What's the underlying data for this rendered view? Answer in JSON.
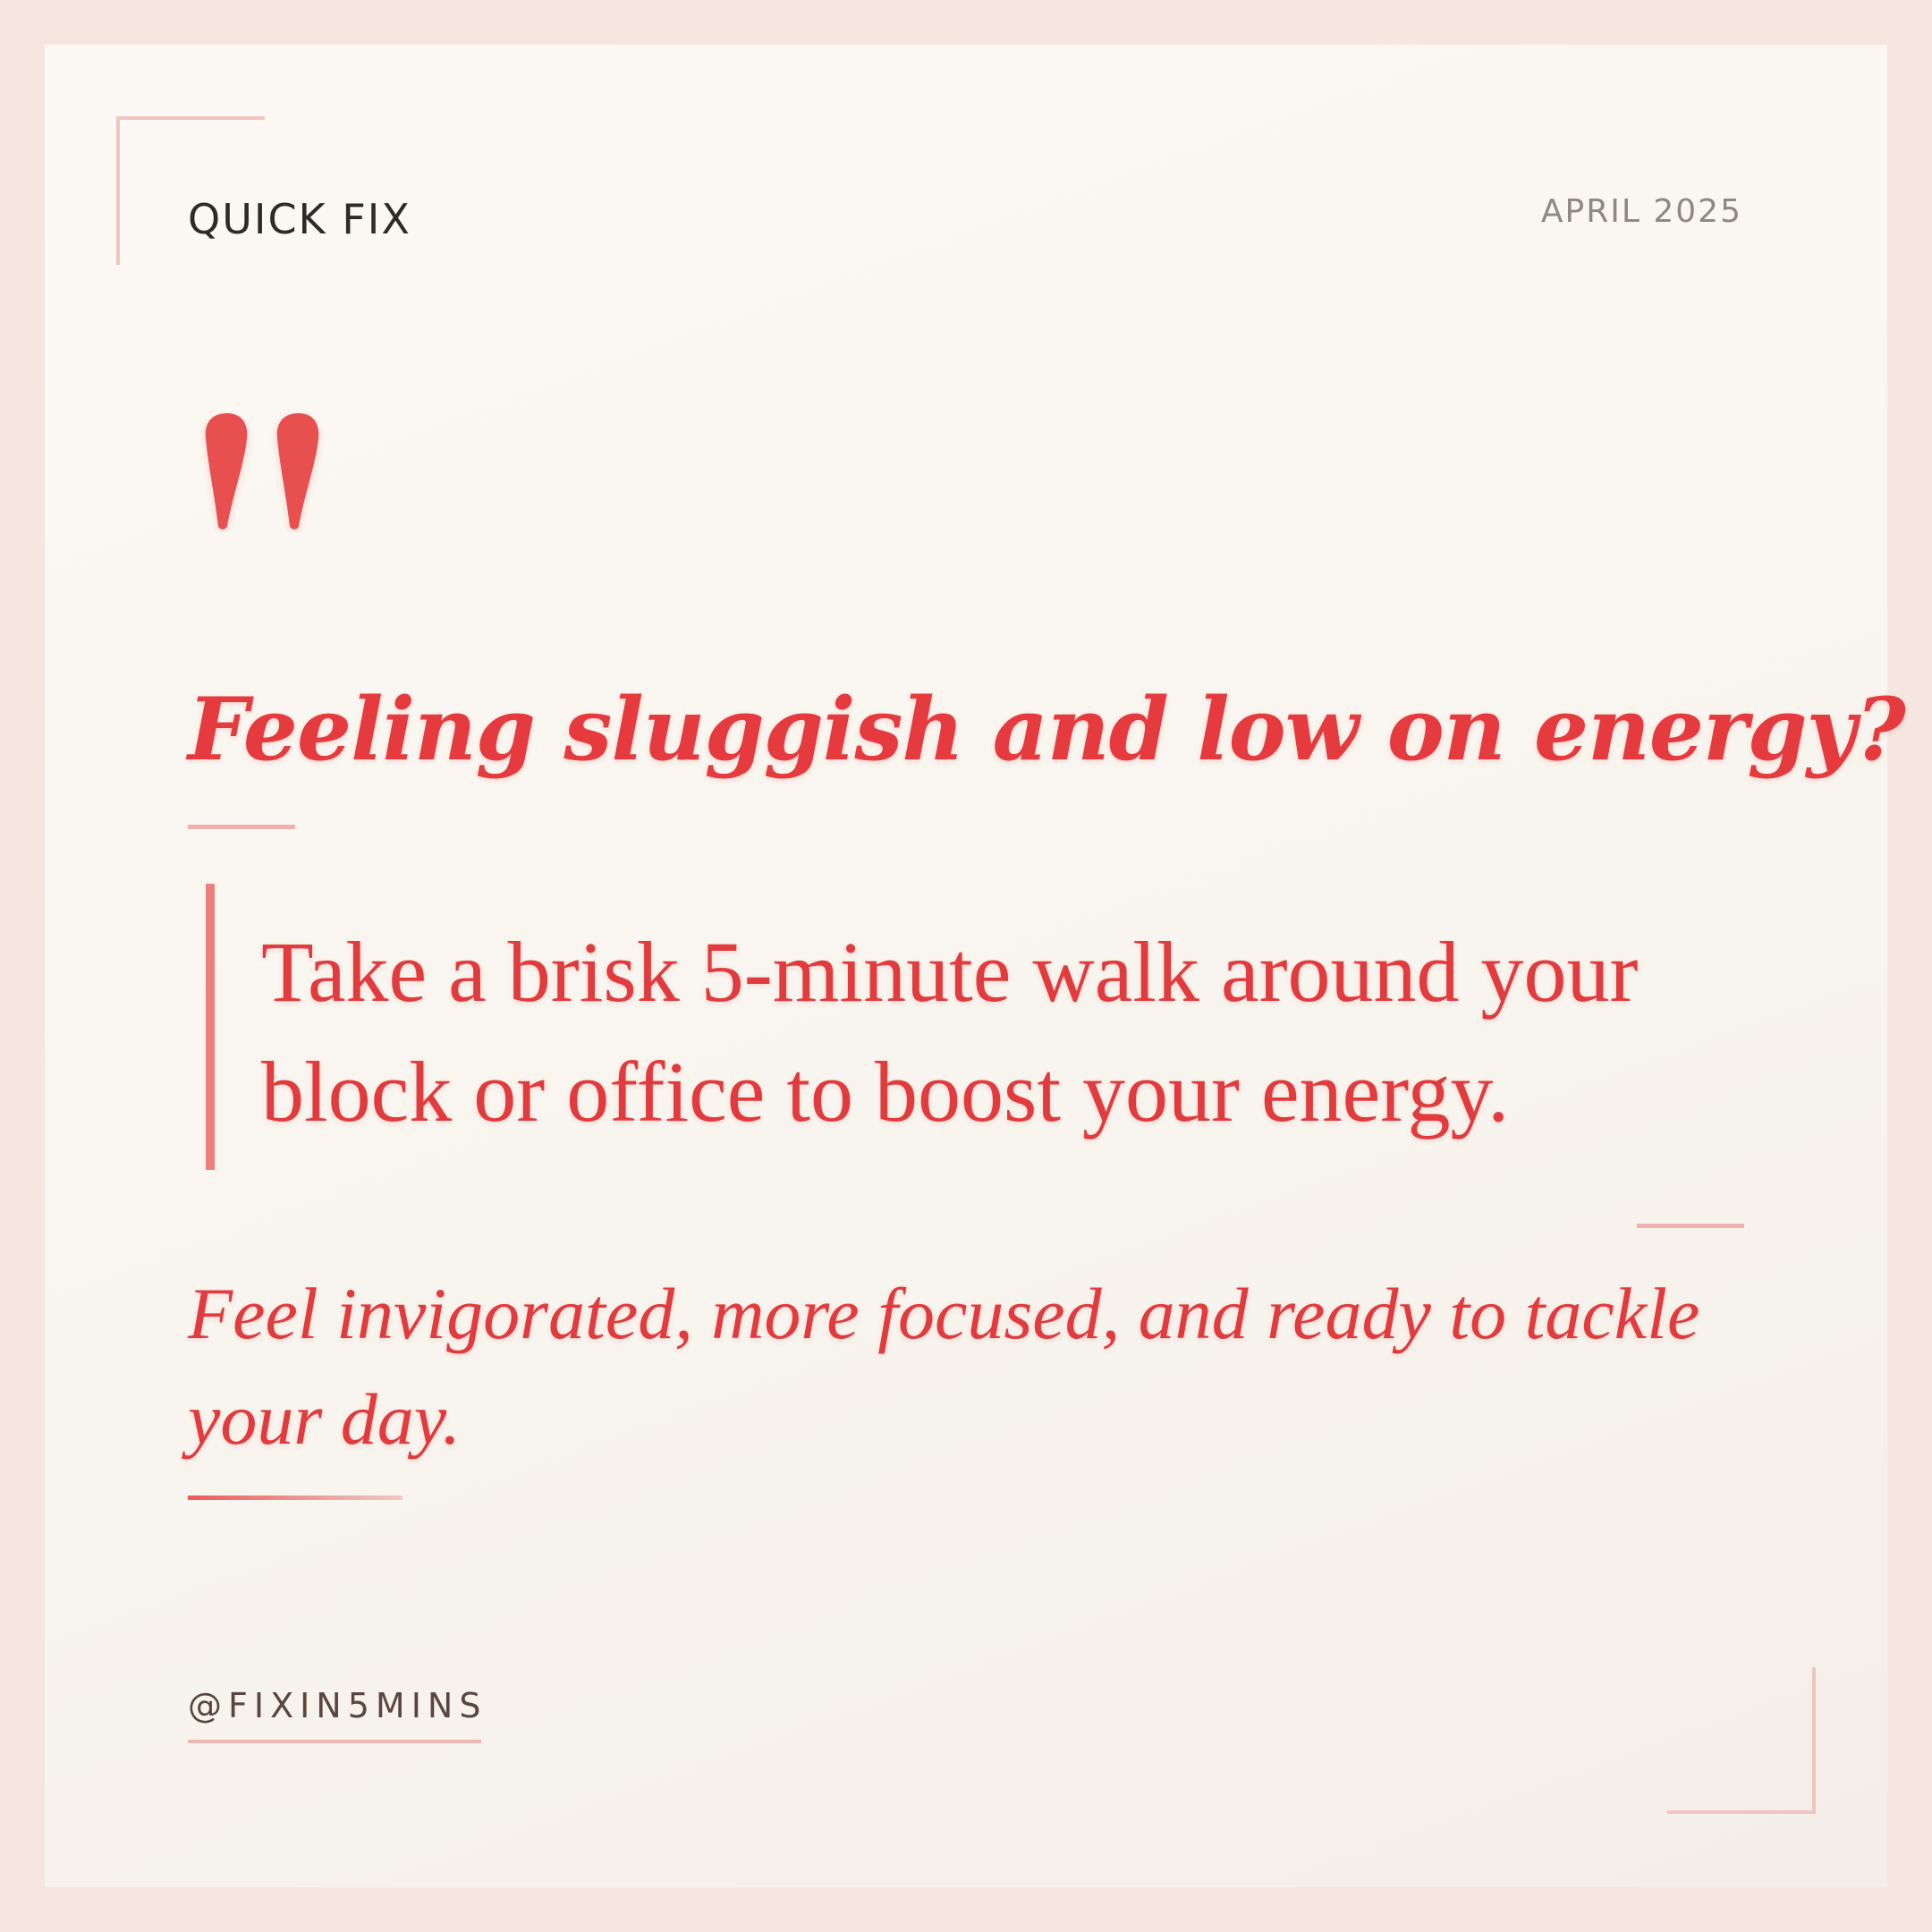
{
  "header": {
    "label": "QUICK FIX",
    "date": "APRIL 2025"
  },
  "content": {
    "headline": "Feeling sluggish and low on energy?",
    "tip_line_1": "Take a brisk 5-minute walk around your",
    "tip_line_2": "block or office to boost your energy.",
    "benefit": "Feel invigorated, more focused, and ready to tackle your day."
  },
  "footer": {
    "handle": "@FIXIN5MINS"
  },
  "colors": {
    "accent": "#e53b3e",
    "accent_soft": "#efb1ad",
    "background": "#fbf7f2",
    "frame": "#f5e6df",
    "text_dark": "#2e2a28",
    "text_muted": "#8f8884"
  },
  "icons": {
    "quote": "quote-mark-icon"
  }
}
